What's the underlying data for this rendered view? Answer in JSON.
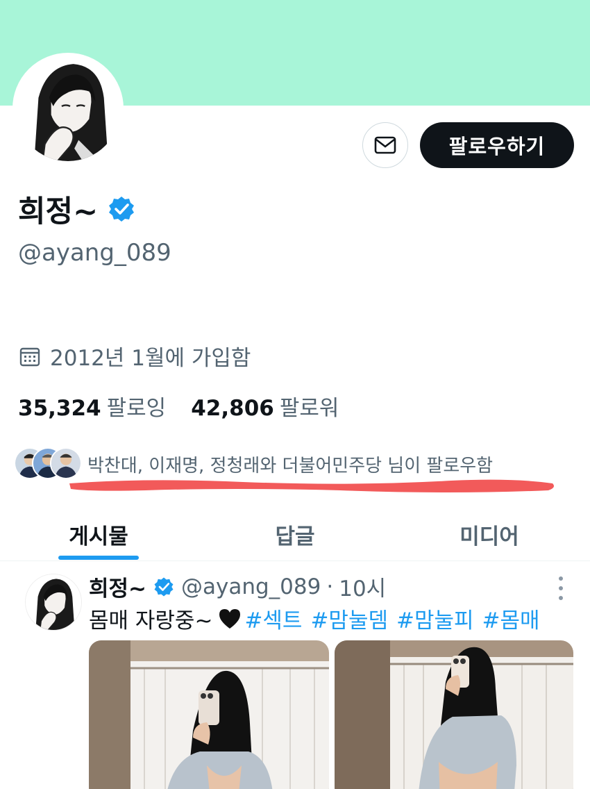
{
  "profile": {
    "banner_color": "#a8f5d8",
    "name": "희정~",
    "handle": "@ayang_089",
    "verified_color": "#1d9bf0",
    "follow_label": "팔로우하기",
    "joined": "2012년 1월에 가입함",
    "following_count": "35,324",
    "following_label": "팔로잉",
    "followers_count": "42,806",
    "followers_label": "팔로워",
    "followed_by": "박찬대, 이재명, 정청래와 더불어민주당 님이 팔로우함"
  },
  "tabs": [
    {
      "label": "게시물",
      "active": true
    },
    {
      "label": "답글",
      "active": false
    },
    {
      "label": "미디어",
      "active": false
    }
  ],
  "post": {
    "name": "희정~",
    "handle": "@ayang_089",
    "separator": "·",
    "time": "10시",
    "text": "몸매 자랑중~",
    "hashtags": [
      "#섹트",
      "#맘눌뎀",
      "#맘눌피",
      "#몸매"
    ]
  },
  "colors": {
    "accent": "#1d9bf0",
    "annotation": "#f25a5a",
    "text_secondary": "#536471"
  }
}
